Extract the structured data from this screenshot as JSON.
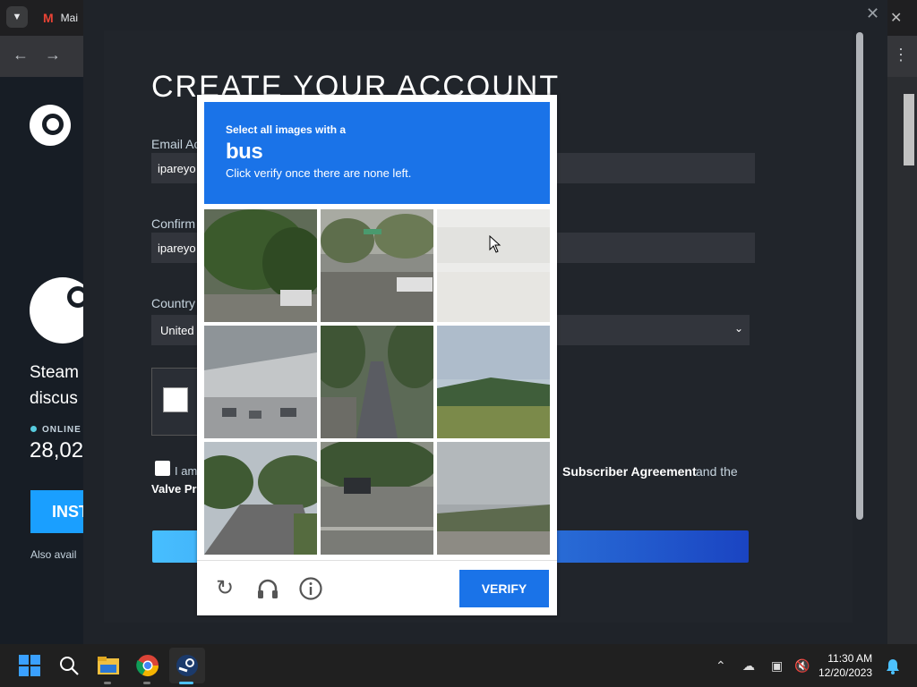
{
  "browser": {
    "tab_title": "Mai",
    "gmail_icon": "gmail-icon"
  },
  "steam_page": {
    "tagline_line1": "Steam",
    "tagline_line2": "discus",
    "online_label": "ONLINE",
    "online_count": "28,02",
    "install_label": "INST",
    "also_available": "Also avail"
  },
  "form": {
    "title": "CREATE YOUR ACCOUNT",
    "email_label": "Email Ac",
    "email_value": "ipareyo",
    "confirm_label": "Confirm",
    "confirm_value": "ipareyo",
    "country_label": "Country",
    "country_value": "United",
    "agree_prefix": "I am",
    "agree_link": "Subscriber Agreement",
    "agree_and": "and the",
    "valve_link": "Valve Pr"
  },
  "captcha": {
    "instruction": "Select all images with a",
    "target": "bus",
    "sub_instruction": "Click verify once there are none left.",
    "verify_label": "VERIFY",
    "accent": "#1a73e8",
    "tiles": [
      "tree-with-car",
      "street-with-sign-and-car",
      "faded-empty-field",
      "highway-overpass-traffic",
      "tree-lined-road",
      "green-valley-hills",
      "road-with-trees",
      "street-with-suv",
      "noisy-road-curve"
    ]
  },
  "taskbar": {
    "time": "11:30 AM",
    "date": "12/20/2023"
  }
}
